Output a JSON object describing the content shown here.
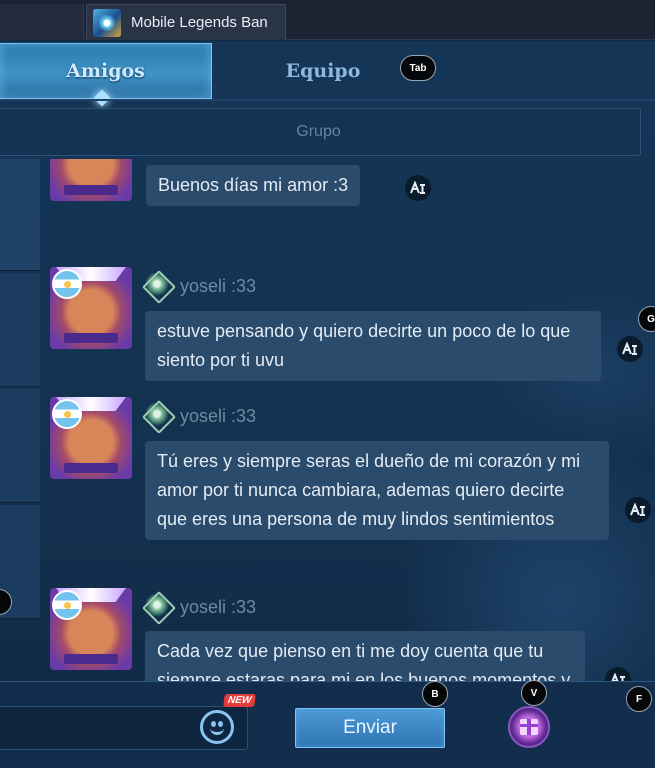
{
  "window": {
    "app_title": "Mobile Legends  Ban"
  },
  "tabs": [
    {
      "label": "Amigos",
      "active": true
    },
    {
      "label": "Equipo",
      "active": false
    }
  ],
  "key_hints": {
    "tab": "Tab",
    "g": "G",
    "b": "B",
    "v": "V",
    "f": "F"
  },
  "group_field": {
    "placeholder": "Grupo"
  },
  "messages": [
    {
      "username": "",
      "text": "Buenos días mi amor :3"
    },
    {
      "username": "yoseli :33",
      "text": "estuve pensando y quiero decirte un poco de lo que siento por ti uvu"
    },
    {
      "username": "yoseli :33",
      "text": "Tú eres y siempre seras el dueño de mi corazón y mi amor por ti nunca cambiara, ademas quiero decirte que eres una persona de muy lindos sentimientos"
    },
    {
      "username": "yoseli :33",
      "text": "Cada vez que pienso en ti me doy cuenta que tu siempre estaras para mi en los buenos momentos y en los malos, lo unico que quiero"
    }
  ],
  "bottom_bar": {
    "new_badge": "NEW",
    "send_label": "Enviar"
  },
  "colors": {
    "background": "#13314f",
    "bubble": "#2b4b6c",
    "accent": "#3f93c6",
    "gift": "#6a2f9c"
  }
}
